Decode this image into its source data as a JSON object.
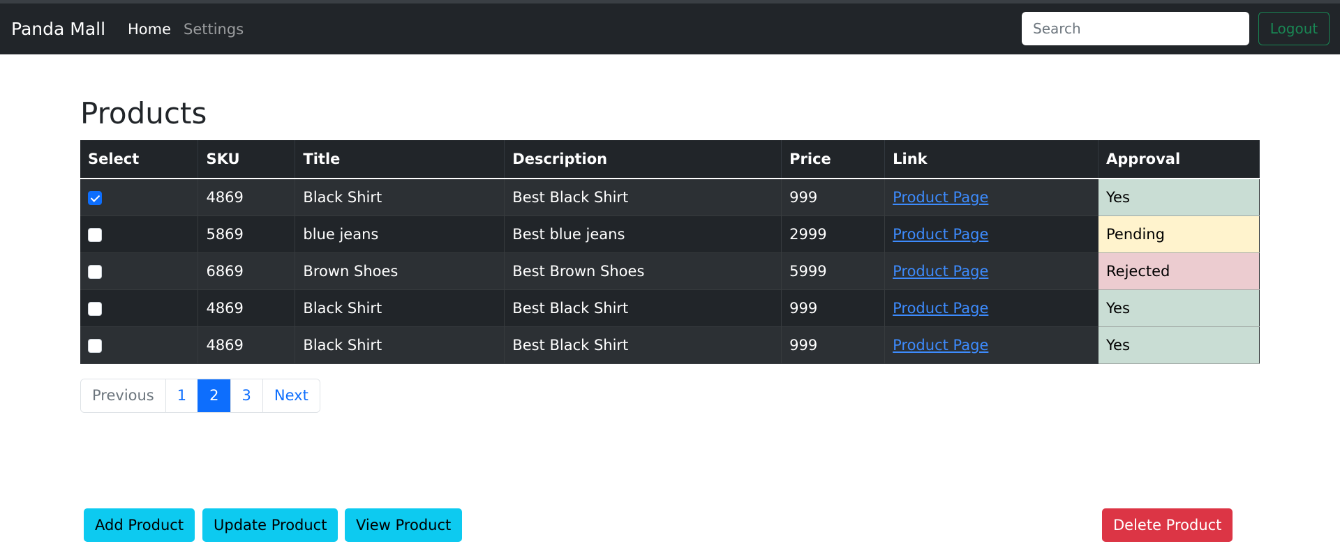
{
  "navbar": {
    "brand": "Panda Mall",
    "links": [
      "Home",
      "Settings"
    ],
    "search_placeholder": "Search",
    "logout_label": "Logout"
  },
  "page": {
    "title": "Products"
  },
  "table": {
    "columns": [
      "Select",
      "SKU",
      "Title",
      "Description",
      "Price",
      "Link",
      "Approval"
    ],
    "rows": [
      {
        "checked": true,
        "sku": "4869",
        "title": "Black Shirt",
        "description": "Best Black Shirt",
        "price": "999",
        "link": "Product Page",
        "approval": "Yes"
      },
      {
        "checked": false,
        "sku": "5869",
        "title": "blue jeans",
        "description": "Best blue jeans",
        "price": "2999",
        "link": "Product Page",
        "approval": "Pending"
      },
      {
        "checked": false,
        "sku": "6869",
        "title": "Brown Shoes",
        "description": "Best Brown Shoes",
        "price": "5999",
        "link": "Product Page",
        "approval": "Rejected"
      },
      {
        "checked": false,
        "sku": "4869",
        "title": "Black Shirt",
        "description": "Best Black Shirt",
        "price": "999",
        "link": "Product Page",
        "approval": "Yes"
      },
      {
        "checked": false,
        "sku": "4869",
        "title": "Black Shirt",
        "description": "Best Black Shirt",
        "price": "999",
        "link": "Product Page",
        "approval": "Yes"
      }
    ],
    "approval_colors": {
      "Yes": "#c9ddd4",
      "Pending": "#fff3cd",
      "Rejected": "#ecccd0"
    }
  },
  "pagination": {
    "items": [
      "Previous",
      "1",
      "2",
      "3",
      "Next"
    ],
    "active": "2"
  },
  "actions": {
    "add_label": "Add Product",
    "update_label": "Update Product",
    "view_label": "View Product",
    "delete_label": "Delete Product"
  }
}
